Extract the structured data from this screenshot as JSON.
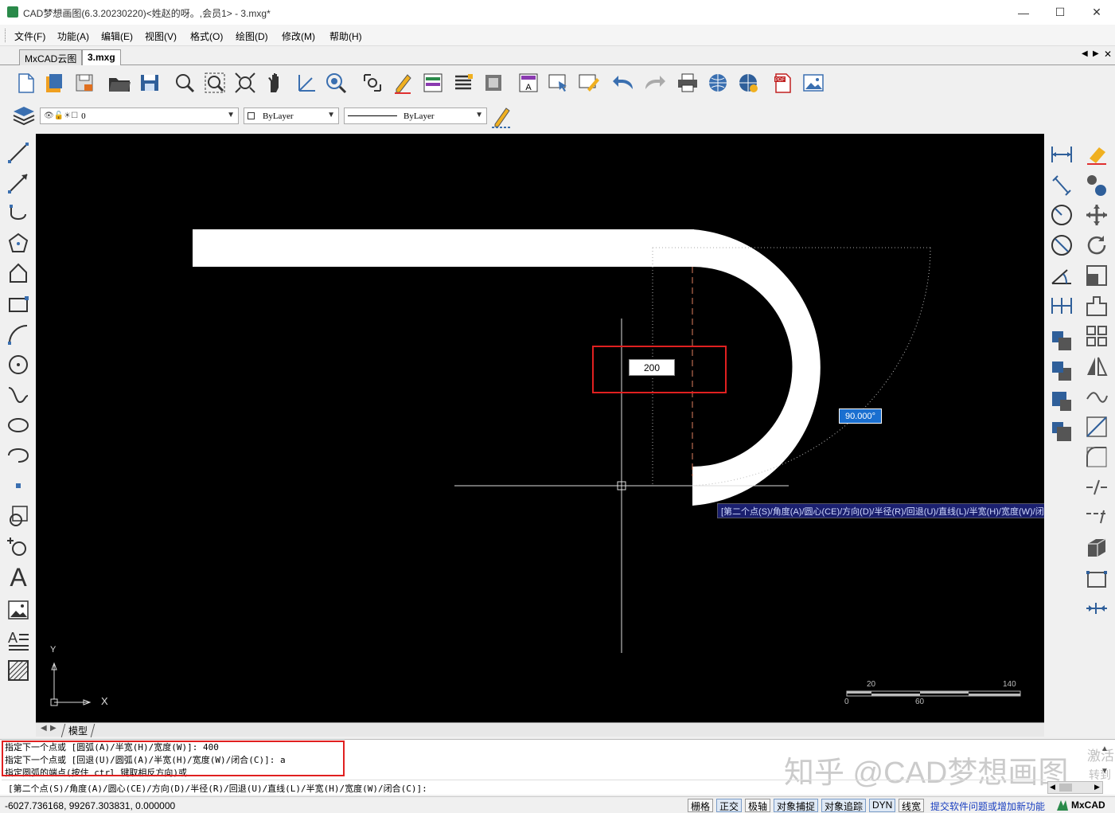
{
  "window": {
    "title": "CAD梦想画图(6.3.20230220)<姓赵的呀。,会员1> - 3.mxg*",
    "minimize": "—",
    "maximize": "☐",
    "close": "✕"
  },
  "menu": [
    "文件(F)",
    "功能(A)",
    "编辑(E)",
    "视图(V)",
    "格式(O)",
    "绘图(D)",
    "修改(M)",
    "帮助(H)"
  ],
  "tabs": {
    "items": [
      "MxCAD云图",
      "3.mxg"
    ],
    "active_index": 1,
    "nav_prev": "◀",
    "nav_next": "▶",
    "close": "✕"
  },
  "toolbar2": {
    "layer_value": "0",
    "color_value": "ByLayer",
    "linetype_value": "ByLayer"
  },
  "canvas": {
    "dimension_input": "200",
    "angle_input": "90.000°",
    "prompt_tooltip": "[第二个点(S)/角度(A)/圆心(CE)/方向(D)/半径(R)/回退(U)/直线(L)/半宽(H)/宽度(W)/闭合(C)]:",
    "ucs_y": "Y",
    "ucs_x": "X",
    "scale_labels_top": [
      "20",
      "140"
    ],
    "scale_labels_bottom": [
      "0",
      "60"
    ]
  },
  "model_tab": "模型",
  "command": {
    "history": [
      "指定下一个点或 [圆弧(A)/半宽(H)/宽度(W)]: 400",
      "指定下一个点或 [回退(U)/圆弧(A)/半宽(H)/宽度(W)/闭合(C)]: a",
      "指定圆弧的端点(按住 ctrl 键取相反方向)或"
    ],
    "current": "[第二个点(S)/角度(A)/圆心(CE)/方向(D)/半径(R)/回退(U)/直线(L)/半宽(H)/宽度(W)/闭合(C)]:",
    "watermark": "知乎 @CAD梦想画图",
    "activate_text_1": "激活",
    "activate_text_2": "转到"
  },
  "status": {
    "coords": "-6027.736168,  99267.303831,  0.000000",
    "buttons": [
      {
        "label": "栅格",
        "on": false
      },
      {
        "label": "正交",
        "on": true
      },
      {
        "label": "极轴",
        "on": false
      },
      {
        "label": "对象捕捉",
        "on": true
      },
      {
        "label": "对象追踪",
        "on": true
      },
      {
        "label": "DYN",
        "on": true
      },
      {
        "label": "线宽",
        "on": false
      }
    ],
    "feedback_link": "提交软件问题或增加新功能",
    "brand": "MxCAD"
  },
  "colors": {
    "canvas_bg": "#000000",
    "highlight_box": "#e02020",
    "tooltip_bg": "#1a1f6e",
    "link": "#1a3fc0"
  }
}
